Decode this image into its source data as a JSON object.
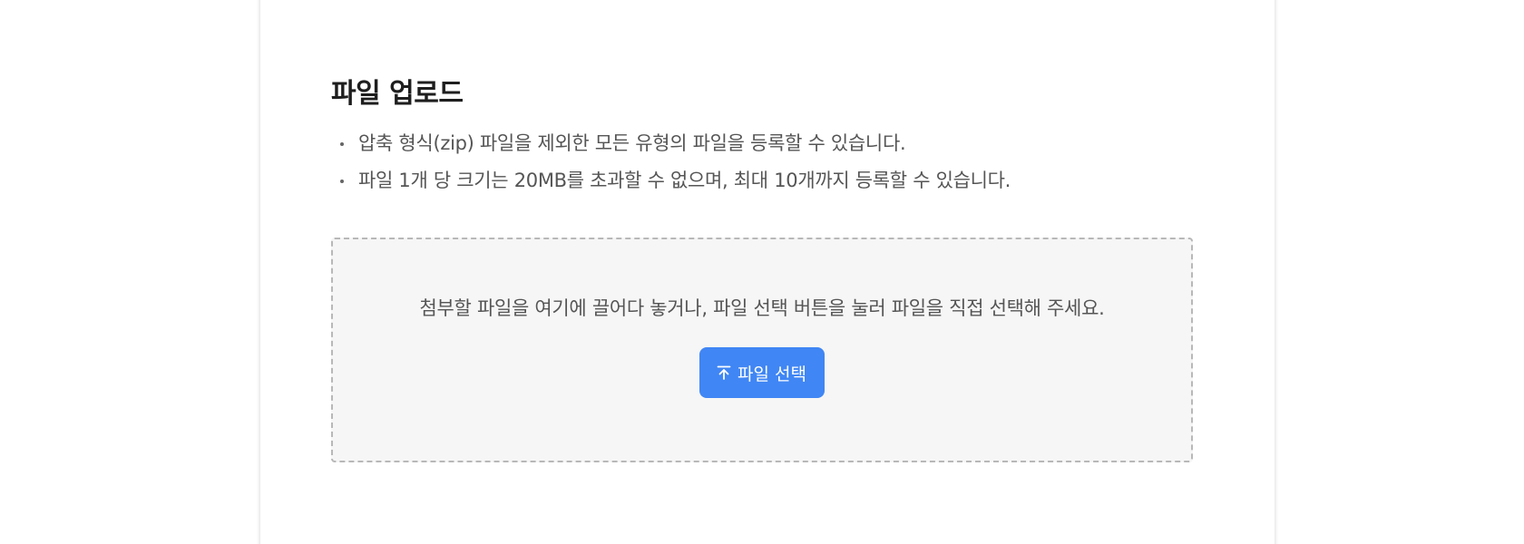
{
  "upload_section": {
    "title": "파일 업로드",
    "guides": [
      "압축 형식(zip) 파일을 제외한 모든 유형의 파일을 등록할 수 있습니다.",
      "파일 1개 당 크기는 20MB를 초과할 수 없으며, 최대 10개까지 등록할 수 있습니다."
    ],
    "dropzone": {
      "instruction": "첨부할 파일을 여기에 끌어다 놓거나, 파일 선택 버튼을 눌러 파일을 직접 선택해 주세요.",
      "button_label": "파일 선택",
      "button_icon": "upload-icon"
    }
  },
  "colors": {
    "accent": "#4086f4",
    "dropzone_bg": "#f6f6f6",
    "dropzone_border": "#b8b8b8"
  }
}
